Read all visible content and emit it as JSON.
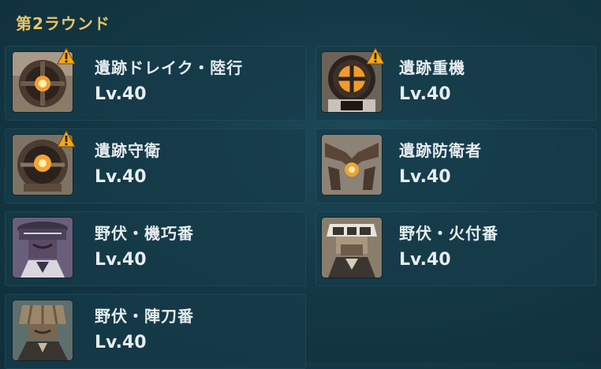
{
  "round": {
    "title": "第2ラウンド"
  },
  "enemies": [
    {
      "name": "遺跡ドレイク・陸行",
      "level": "Lv.40",
      "warning": true,
      "portrait": "ruin-drake-portrait-icon"
    },
    {
      "name": "遺跡重機",
      "level": "Lv.40",
      "warning": true,
      "portrait": "ruin-grader-portrait-icon"
    },
    {
      "name": "遺跡守衛",
      "level": "Lv.40",
      "warning": true,
      "portrait": "ruin-guard-portrait-icon"
    },
    {
      "name": "遺跡防衛者",
      "level": "Lv.40",
      "warning": false,
      "portrait": "ruin-defender-portrait-icon"
    },
    {
      "name": "野伏・機巧番",
      "level": "Lv.40",
      "warning": false,
      "portrait": "nobushi-kikou-portrait-icon"
    },
    {
      "name": "野伏・火付番",
      "level": "Lv.40",
      "warning": false,
      "portrait": "nobushi-hitsuke-portrait-icon"
    },
    {
      "name": "野伏・陣刀番",
      "level": "Lv.40",
      "warning": false,
      "portrait": "nobushi-jintou-portrait-icon"
    }
  ],
  "colors": {
    "accent": "#e9c46a",
    "warning": "#f2a81d",
    "card": "#163c49"
  }
}
